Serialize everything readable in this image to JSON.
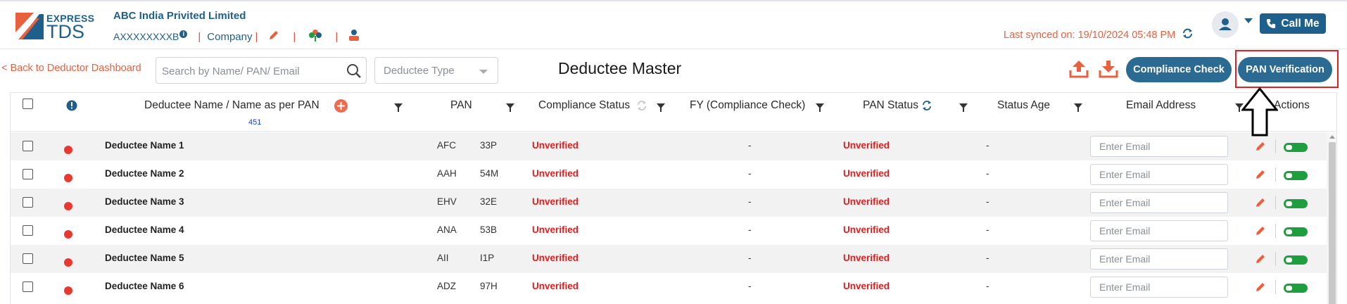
{
  "header": {
    "brand_line1": "EXPRESS",
    "brand_line2": "TDS",
    "company_name": "ABC India Privited Limited",
    "tan": "AXXXXXXXXB",
    "info_badge": "i",
    "company_label": "Company",
    "separator": "|",
    "last_synced": "Last synced on: 19/10/2024 05:48 PM",
    "call_me": "Call Me"
  },
  "toolbar": {
    "back_link": "< Back to Deductor Dashboard",
    "search_placeholder": "Search by Name/ PAN/ Email",
    "deductee_type": "Deductee Type",
    "page_title": "Deductee Master",
    "compliance_check": "Compliance Check",
    "pan_verification": "PAN Verification"
  },
  "table": {
    "columns": {
      "name": "Deductee Name / Name as per PAN",
      "name_count": "451",
      "pan": "PAN",
      "compliance_status": "Compliance Status",
      "fy": "FY (Compliance Check)",
      "pan_status": "PAN Status",
      "status_age": "Status Age",
      "email": "Email Address",
      "actions": "Actions"
    },
    "email_placeholder": "Enter Email",
    "rows": [
      {
        "name": "Deductee Name 1",
        "pan_a": "AFC",
        "pan_b": "33P",
        "compliance": "Unverified",
        "fy": "-",
        "pan_status": "Unverified",
        "age": "-"
      },
      {
        "name": "Deductee Name 2",
        "pan_a": "AAH",
        "pan_b": "54M",
        "compliance": "Unverified",
        "fy": "-",
        "pan_status": "Unverified",
        "age": "-"
      },
      {
        "name": "Deductee Name 3",
        "pan_a": "EHV",
        "pan_b": "32E",
        "compliance": "Unverified",
        "fy": "-",
        "pan_status": "Unverified",
        "age": "-"
      },
      {
        "name": "Deductee Name 4",
        "pan_a": "ANA",
        "pan_b": "53B",
        "compliance": "Unverified",
        "fy": "-",
        "pan_status": "Unverified",
        "age": "-"
      },
      {
        "name": "Deductee Name 5",
        "pan_a": "AII",
        "pan_b": "I1P",
        "compliance": "Unverified",
        "fy": "-",
        "pan_status": "Unverified",
        "age": "-"
      },
      {
        "name": "Deductee Name 6",
        "pan_a": "ADZ",
        "pan_b": "97H",
        "compliance": "Unverified",
        "fy": "-",
        "pan_status": "Unverified",
        "age": "-"
      }
    ]
  },
  "colors": {
    "brand_blue": "#1f5f8b",
    "accent_orange": "#e8613f",
    "status_red": "#e02020",
    "toggle_green": "#1e9e3e"
  }
}
